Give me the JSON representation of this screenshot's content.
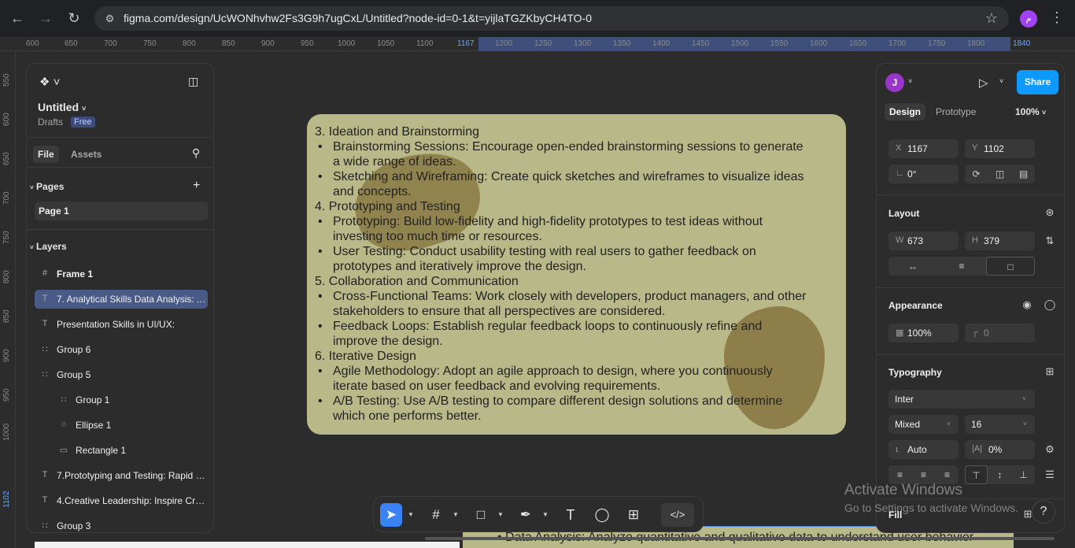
{
  "browser": {
    "url": "figma.com/design/UcWONhvhw2Fs3G9h7ugCxL/Untitled?node-id=0-1&t=yijlaTGZKbyCH4TO-0",
    "profile_initial": "م"
  },
  "rulers": {
    "h_ticks": [
      "600",
      "650",
      "700",
      "750",
      "800",
      "850",
      "900",
      "950",
      "1000",
      "1050",
      "1100",
      "1167",
      "1200",
      "1250",
      "1300",
      "1350",
      "1400",
      "1450",
      "1500",
      "1550",
      "1600",
      "1650",
      "1700",
      "1750",
      "1800",
      "1840"
    ],
    "v_ticks": [
      "550",
      "600",
      "650",
      "700",
      "750",
      "800",
      "850",
      "900",
      "950",
      "1000",
      "1102"
    ]
  },
  "left_panel": {
    "file_name": "Untitled",
    "drafts": "Drafts",
    "plan_badge": "Free",
    "tabs": {
      "file": "File",
      "assets": "Assets"
    },
    "pages_title": "Pages",
    "pages": [
      "Page 1"
    ],
    "layers_title": "Layers",
    "layers": [
      {
        "icon": "#",
        "name": "Frame 1",
        "indent": 0,
        "bold": true
      },
      {
        "icon": "T",
        "name": "7. Analytical Skills Data Analysis: A...",
        "indent": 0,
        "selected": true
      },
      {
        "icon": "T",
        "name": "Presentation Skills in UI/UX:",
        "indent": 0
      },
      {
        "icon": "∷",
        "name": "Group 6",
        "indent": 0
      },
      {
        "icon": "∷",
        "name": "Group 5",
        "indent": 0
      },
      {
        "icon": "∷",
        "name": "Group 1",
        "indent": 1
      },
      {
        "icon": "○",
        "name": "Ellipse 1",
        "indent": 1
      },
      {
        "icon": "▭",
        "name": "Rectangle 1",
        "indent": 1
      },
      {
        "icon": "T",
        "name": "7.Prototyping and Testing: Rapid P...",
        "indent": 0
      },
      {
        "icon": "T",
        "name": "4.Creative Leadership: Inspire Cre...",
        "indent": 0
      },
      {
        "icon": "∷",
        "name": "Group 3",
        "indent": 0
      }
    ]
  },
  "canvas": {
    "lines": [
      {
        "kind": "heading",
        "text": "3. Ideation and Brainstorming"
      },
      {
        "kind": "bullet",
        "text": "Brainstorming Sessions: Encourage open-ended brainstorming sessions to generate"
      },
      {
        "kind": "cont",
        "text": "a wide range of ideas."
      },
      {
        "kind": "bullet",
        "text": "Sketching and Wireframing: Create quick sketches and wireframes to visualize ideas"
      },
      {
        "kind": "cont",
        "text": "and concepts."
      },
      {
        "kind": "heading",
        "text": "4. Prototyping and Testing"
      },
      {
        "kind": "bullet",
        "text": "Prototyping: Build low-fidelity and high-fidelity prototypes to test ideas without"
      },
      {
        "kind": "cont",
        "text": "investing too much time or resources."
      },
      {
        "kind": "bullet",
        "text": "User Testing: Conduct usability testing with real users to gather feedback on"
      },
      {
        "kind": "cont",
        "text": "prototypes and iteratively improve the design."
      },
      {
        "kind": "heading",
        "text": "5. Collaboration and Communication"
      },
      {
        "kind": "bullet",
        "text": "Cross-Functional Teams: Work closely with developers, product managers, and other"
      },
      {
        "kind": "cont",
        "text": "stakeholders to ensure that all perspectives are considered."
      },
      {
        "kind": "bullet",
        "text": "Feedback Loops: Establish regular feedback loops to continuously refine and"
      },
      {
        "kind": "cont",
        "text": "improve the design."
      },
      {
        "kind": "heading",
        "text": "6. Iterative Design"
      },
      {
        "kind": "bullet",
        "text": "Agile Methodology: Adopt an agile approach to design, where you continuously"
      },
      {
        "kind": "cont",
        "text": "iterate based on user feedback and evolving requirements."
      },
      {
        "kind": "bullet",
        "text": "A/B Testing: Use A/B testing to compare different design solutions and determine"
      },
      {
        "kind": "cont",
        "text": "which one performs better."
      }
    ],
    "below_text": "Data Analysis: Analyze quantitative and qualitative data to understand user behavior"
  },
  "right_panel": {
    "avatar_initial": "J",
    "share": "Share",
    "tabs": {
      "design": "Design",
      "prototype": "Prototype"
    },
    "zoom": "100%",
    "position": {
      "x_label": "X",
      "x": "1167",
      "y_label": "Y",
      "y": "1102",
      "rotation": "0°"
    },
    "layout": {
      "title": "Layout",
      "w_label": "W",
      "w": "673",
      "h_label": "H",
      "h": "379"
    },
    "appearance": {
      "title": "Appearance",
      "opacity": "100%",
      "radius": "0"
    },
    "typography": {
      "title": "Typography",
      "font": "Inter",
      "weight": "Mixed",
      "size": "16",
      "line_height": "Auto",
      "letter_spacing": "0%"
    },
    "fill": {
      "title": "Fill"
    }
  },
  "watermark": {
    "line1": "Activate Windows",
    "line2": "Go to Settings to activate Windows."
  },
  "help": "?"
}
